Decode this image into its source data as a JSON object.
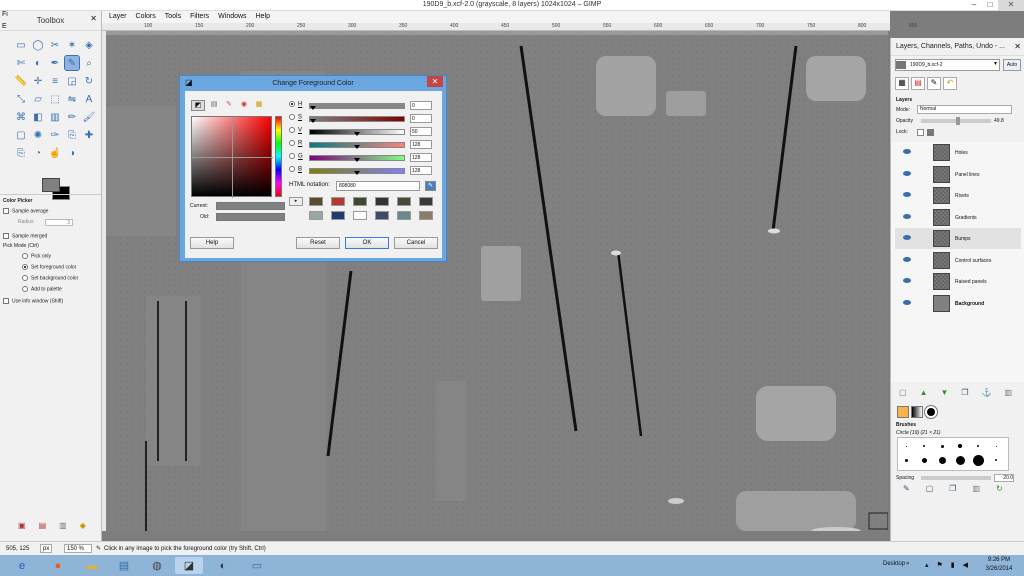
{
  "window": {
    "title": "190D9_b.xcf-2.0 (grayscale, 8 layers) 1024x1024 – GIMP",
    "min": "–",
    "max": "□",
    "close": "✕"
  },
  "toolbox": {
    "title": "Toolbox",
    "icons": [
      "rect-select",
      "ellipse-select",
      "free-select",
      "fuzzy-select",
      "select-by-color",
      "scissors",
      "foreground-select",
      "paths",
      "color-picker",
      "zoom",
      "measure",
      "move",
      "align",
      "crop",
      "rotate",
      "scale",
      "shear",
      "perspective",
      "flip",
      "text",
      "cage",
      "bucket-fill",
      "blend",
      "pencil",
      "paintbrush",
      "eraser",
      "airbrush",
      "ink",
      "clone",
      "heal",
      "perspective-clone",
      "blur",
      "smudge",
      "dodge-burn"
    ],
    "options_title": "Color Picker",
    "sample_average": "Sample average",
    "radius_label": "Radius",
    "radius_value": "3",
    "sample_merged": "Sample merged",
    "pick_mode": "Pick Mode  (Ctrl)",
    "pick_only": "Pick only",
    "set_fg": "Set foreground color",
    "set_bg": "Set background color",
    "add_palette": "Add to palette",
    "use_info": "Use info window  (Shift)"
  },
  "menu": [
    "Layer",
    "Colors",
    "Tools",
    "Filters",
    "Windows",
    "Help"
  ],
  "menu_left": "Fi",
  "menu_left2": "E",
  "ruler_ticks": [
    "100",
    "150",
    "200",
    "250",
    "300",
    "350",
    "400",
    "450",
    "500",
    "550",
    "600",
    "650",
    "700",
    "750",
    "800",
    "850"
  ],
  "status": {
    "coords": "505, 125",
    "unit": "px",
    "zoom": "150 %",
    "message": "Click in any image to pick the foreground color (try Shift, Ctrl)"
  },
  "dialog": {
    "title": "Change Foreground Color",
    "close": "✕",
    "channels": [
      {
        "name": "H",
        "value": "0"
      },
      {
        "name": "S",
        "value": "0"
      },
      {
        "name": "V",
        "value": "50"
      },
      {
        "name": "R",
        "value": "128"
      },
      {
        "name": "G",
        "value": "128"
      },
      {
        "name": "B",
        "value": "128"
      }
    ],
    "html_label": "HTML notation:",
    "html_value": "808080",
    "current_label": "Current:",
    "old_label": "Old:",
    "help": "Help",
    "reset": "Reset",
    "ok": "OK",
    "cancel": "Cancel",
    "history_colors": [
      "#5a4a30",
      "#b23a2e",
      "#3d4a30",
      "#333333",
      "#4a4a3a",
      "#3a3a3a",
      "#9aa7a5",
      "#1f3b6b",
      "#ffffff",
      "#3f4a6a",
      "#6a8b8b",
      "#8a7e6a"
    ]
  },
  "dock": {
    "title": "Layers, Channels, Paths, Undo - ...",
    "image_select": "190D9_b.xcf-2",
    "auto": "Auto",
    "layers_label": "Layers",
    "mode_label": "Mode:",
    "mode_value": "Normal",
    "opacity_label": "Opacity",
    "opacity_value": "49.8",
    "lock_label": "Lock:",
    "layers": [
      "Holes",
      "Panel lines",
      "Rivets",
      "Gradients",
      "Bumps",
      "Control surfaces",
      "Raised panels",
      "Background"
    ],
    "brushes_label": "Brushes",
    "brush_name": "Circle (19) (21 × 21)",
    "spacing_label": "Spacing",
    "spacing_value": "20.0"
  },
  "taskbar": {
    "desktop": "Desktop",
    "time": "9:26 PM",
    "date": "3/26/2014"
  }
}
